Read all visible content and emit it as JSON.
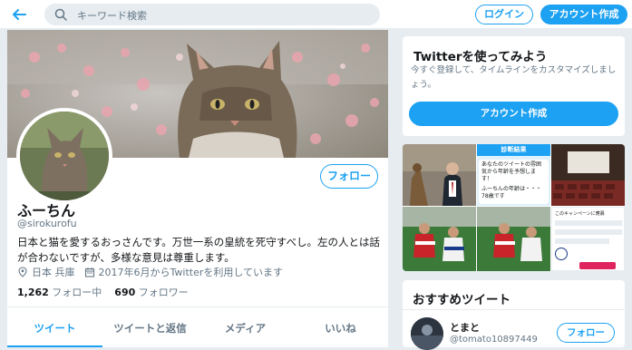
{
  "header": {
    "search_placeholder": "キーワード検索",
    "login_label": "ログイン",
    "signup_label": "アカウント作成"
  },
  "profile": {
    "follow_label": "フォロー",
    "name": "ふーちん",
    "handle": "@sirokurofu",
    "bio": "日本と猫を愛するおっさんです。万世一系の皇統を死守すべし。左の人とは話が合わないですが、多様な意見は尊重します。",
    "location": "日本 兵庫",
    "joined": "2017年6月からTwitterを利用しています",
    "following_count": "1,262",
    "following_label": "フォロー中",
    "followers_count": "690",
    "followers_label": "フォロワー",
    "tabs": [
      {
        "label": "ツイート",
        "active": true
      },
      {
        "label": "ツイートと返信",
        "active": false
      },
      {
        "label": "メディア",
        "active": false
      },
      {
        "label": "いいね",
        "active": false
      }
    ]
  },
  "signup_card": {
    "title": "Twitterを使ってみよう",
    "description": "今すぐ登録して、タイムラインをカスタマイズしましょう。",
    "cta_label": "アカウント作成"
  },
  "media_grid": {
    "diag_header": "診断結果",
    "diag_text": "あなたのツイートの雰囲気から年齢を予想します！",
    "diag_result": "ふーちんの年齢は・・・78歳です",
    "campaign_text": "このキャンペーンに應募"
  },
  "recommended": {
    "title": "おすすめツイート",
    "user_name": "とまと",
    "user_handle": "@tomato10897449",
    "follow_label": "フォロー"
  },
  "colors": {
    "accent": "#1da1f2",
    "background": "#e6ecf0",
    "muted_text": "#657786"
  }
}
